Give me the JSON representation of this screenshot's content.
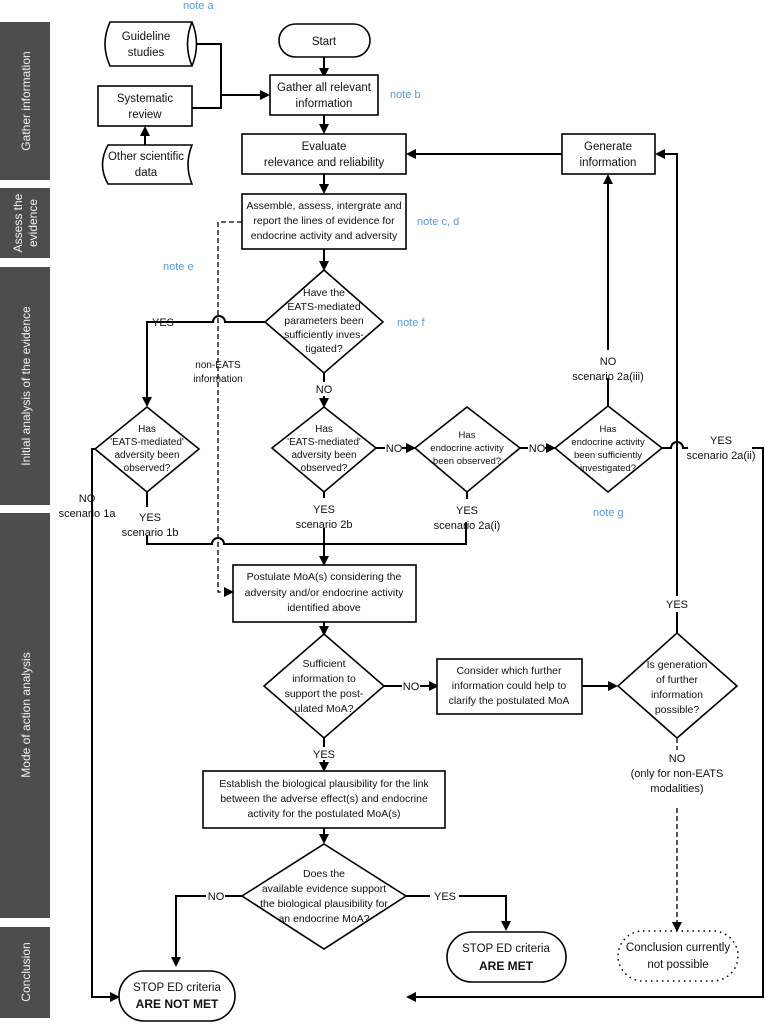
{
  "bands": [
    {
      "label": "Gather information"
    },
    {
      "label_line1": "Assess the",
      "label_line2": "evidence"
    },
    {
      "label": "Initial analysis of the evidence"
    },
    {
      "label": "Mode of action analysis"
    },
    {
      "label": "Conclusion"
    }
  ],
  "notes": {
    "a": "note a",
    "b": "note b",
    "cd": "note c, d",
    "e": "note e",
    "f": "note f",
    "g": "note g"
  },
  "nodes": {
    "guideline": [
      "Guideline",
      "studies"
    ],
    "systematic": [
      "Systematic",
      "review"
    ],
    "other": [
      "Other scientific",
      "data"
    ],
    "start": "Start",
    "gather": [
      "Gather all relevant",
      "information"
    ],
    "evaluate": [
      "Evaluate",
      "relevance and reliability"
    ],
    "generate": [
      "Generate",
      "information"
    ],
    "assemble": [
      "Assemble, assess, intergrate and",
      "report the lines of evidence for",
      "endocrine activity and adversity"
    ],
    "q_eats_investigated": [
      "Have the",
      "EATS-mediated",
      "parameters been",
      "sufficiently  inves-",
      "tigated?"
    ],
    "q_eats_adversity_left": [
      "Has",
      "'EATS-mediated'",
      "adversity been",
      "observed?"
    ],
    "q_eats_adversity_mid": [
      "Has",
      "'EATS-mediated'",
      "adversity been",
      "observed?"
    ],
    "q_endocrine_observed": [
      "Has",
      "endocrine activity",
      "been observed?"
    ],
    "q_endocrine_investigated": [
      "Has",
      "endocrine activity",
      "been sufficiently",
      "investigated?"
    ],
    "postulate": [
      "Postulate MoA(s) considering the",
      "adversity and/or endocrine activity",
      "identified above"
    ],
    "q_sufficient": [
      "Sufficient",
      "information to",
      "support the post-",
      "ulated MoA?"
    ],
    "consider": [
      "Consider which further",
      "information could help to",
      "clarify the postulated MoA"
    ],
    "q_generation": [
      "Is generation",
      "of further",
      "information",
      "possible?"
    ],
    "establish": [
      "Establish the biological plausibility for the link",
      "between the adverse effect(s) and endocrine",
      "activity for the postulated MoA(s)"
    ],
    "q_evidence": [
      "Does the",
      "available evidence support",
      "the biological plausibility for",
      "an endocrine MoA?"
    ],
    "stop_met": [
      "STOP ED criteria",
      "ARE MET"
    ],
    "stop_not_met": [
      "STOP ED criteria",
      "ARE NOT MET"
    ],
    "conclusion_not_possible": [
      "Conclusion currently",
      "not possible"
    ]
  },
  "edges": {
    "yes": "YES",
    "no": "NO",
    "non_eats": [
      "non-EATS",
      "information"
    ],
    "no_1a": [
      "NO",
      "scenario 1a"
    ],
    "yes_1b": [
      "YES",
      "scenario 1b"
    ],
    "yes_2b": [
      "YES",
      "scenario 2b"
    ],
    "yes_2ai": [
      "YES",
      "scenario 2a(i)"
    ],
    "yes_2aii": [
      "YES",
      "scenario 2a(ii)"
    ],
    "no_2aiii": [
      "NO",
      "scenario 2a(iii)"
    ],
    "no_non_eats": [
      "NO",
      "(only for non-EATS",
      "modalities)"
    ]
  },
  "colors": {
    "band": "#4d4d4d",
    "note": "#5b9bd5"
  }
}
